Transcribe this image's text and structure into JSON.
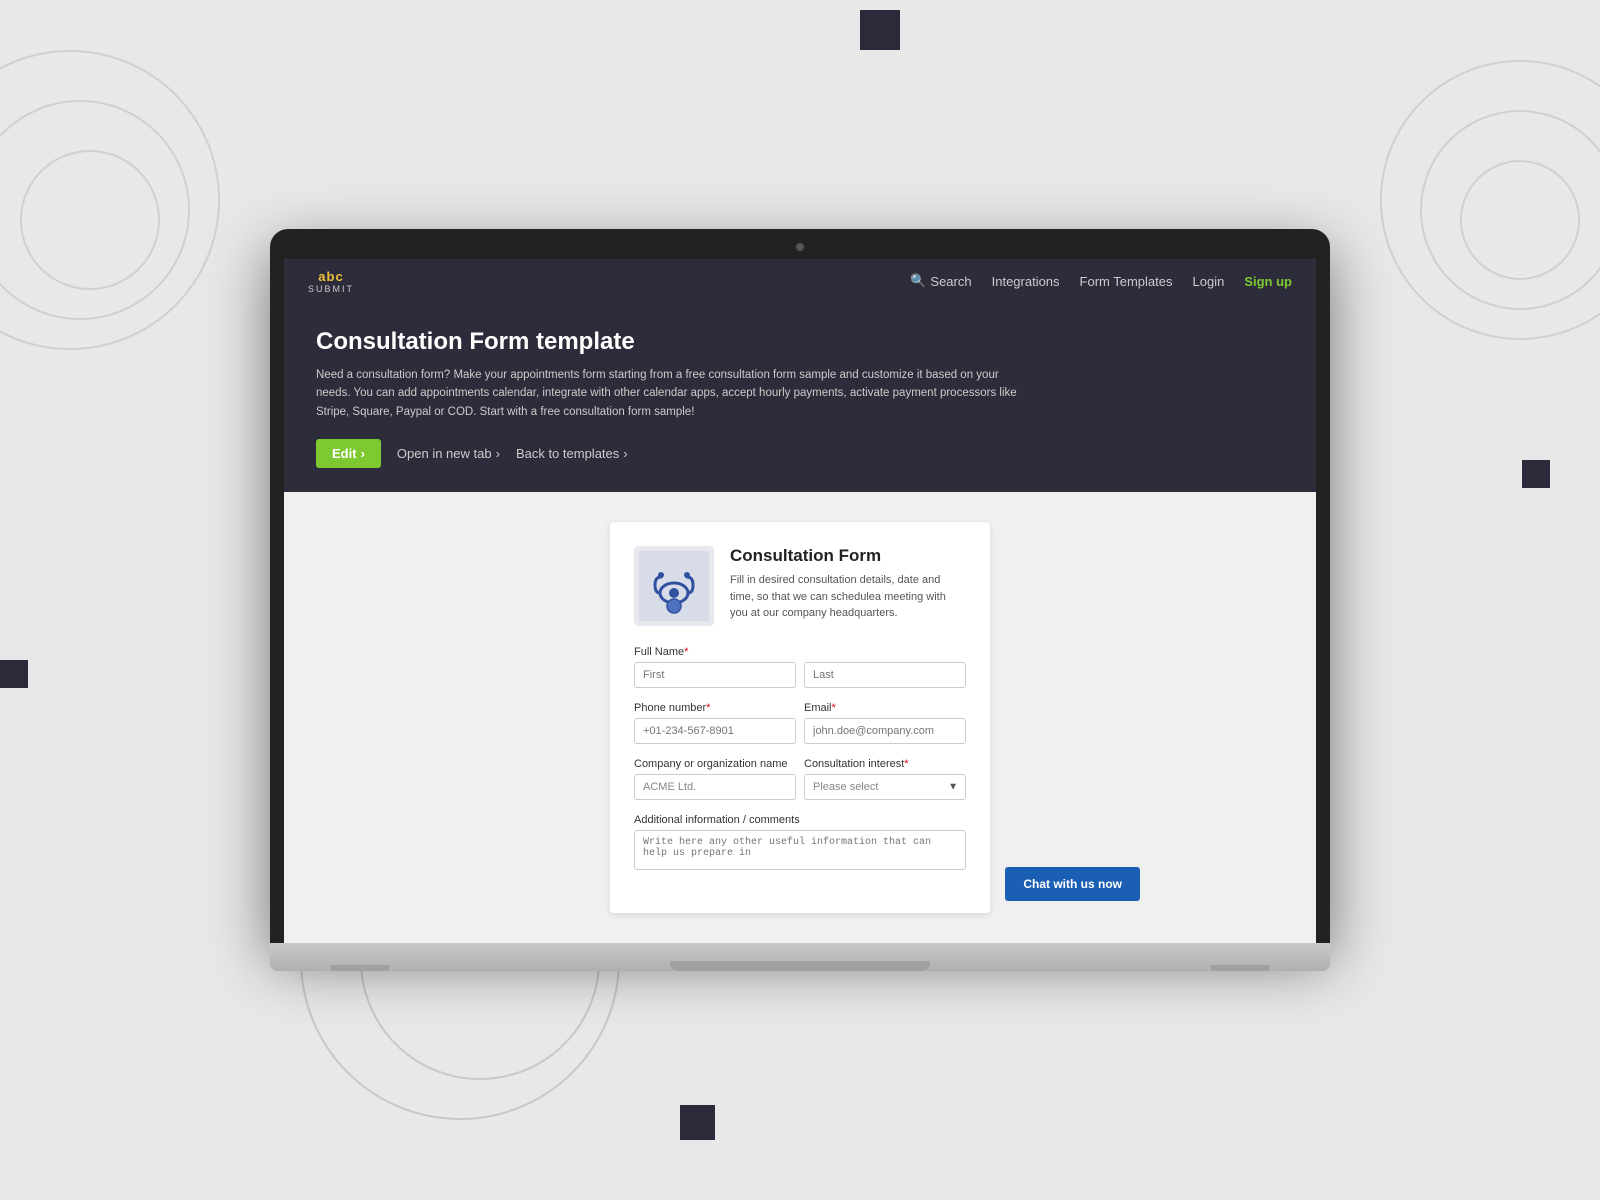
{
  "background": {
    "color": "#e8e8e8"
  },
  "nav": {
    "logo_text": "abc",
    "logo_sub": "SUBMIT",
    "links": [
      {
        "label": "Search",
        "icon": "search",
        "href": "#"
      },
      {
        "label": "Integrations",
        "href": "#"
      },
      {
        "label": "Form Templates",
        "href": "#"
      },
      {
        "label": "Login",
        "href": "#"
      },
      {
        "label": "Sign up",
        "href": "#",
        "variant": "signup"
      }
    ]
  },
  "hero": {
    "title": "Consultation Form template",
    "description": "Need a consultation form? Make your appointments form starting from a free consultation form sample and customize it based on your needs. You can add appointments calendar, integrate with other calendar apps, accept hourly payments, activate payment processors like Stripe, Square, Paypal or COD. Start with a free consultation form sample!",
    "edit_label": "Edit",
    "open_new_tab_label": "Open in new tab",
    "back_to_templates_label": "Back to templates"
  },
  "form": {
    "title": "Consultation Form",
    "subtitle": "Fill in desired consultation details, date and time, so that we can schedulea meeting with you at our company headquarters.",
    "fields": {
      "full_name_label": "Full Name",
      "first_placeholder": "First",
      "last_placeholder": "Last",
      "phone_label": "Phone number",
      "phone_placeholder": "+01-234-567-8901",
      "email_label": "Email",
      "email_placeholder": "john.doe@company.com",
      "company_label": "Company or organization name",
      "company_value": "ACME Ltd.",
      "consultation_interest_label": "Consultation interest",
      "consultation_interest_placeholder": "Please select",
      "additional_info_label": "Additional information / comments",
      "additional_info_placeholder": "Write here any other useful information that can help us prepare in"
    },
    "chat_button_label": "Chat with us now"
  }
}
